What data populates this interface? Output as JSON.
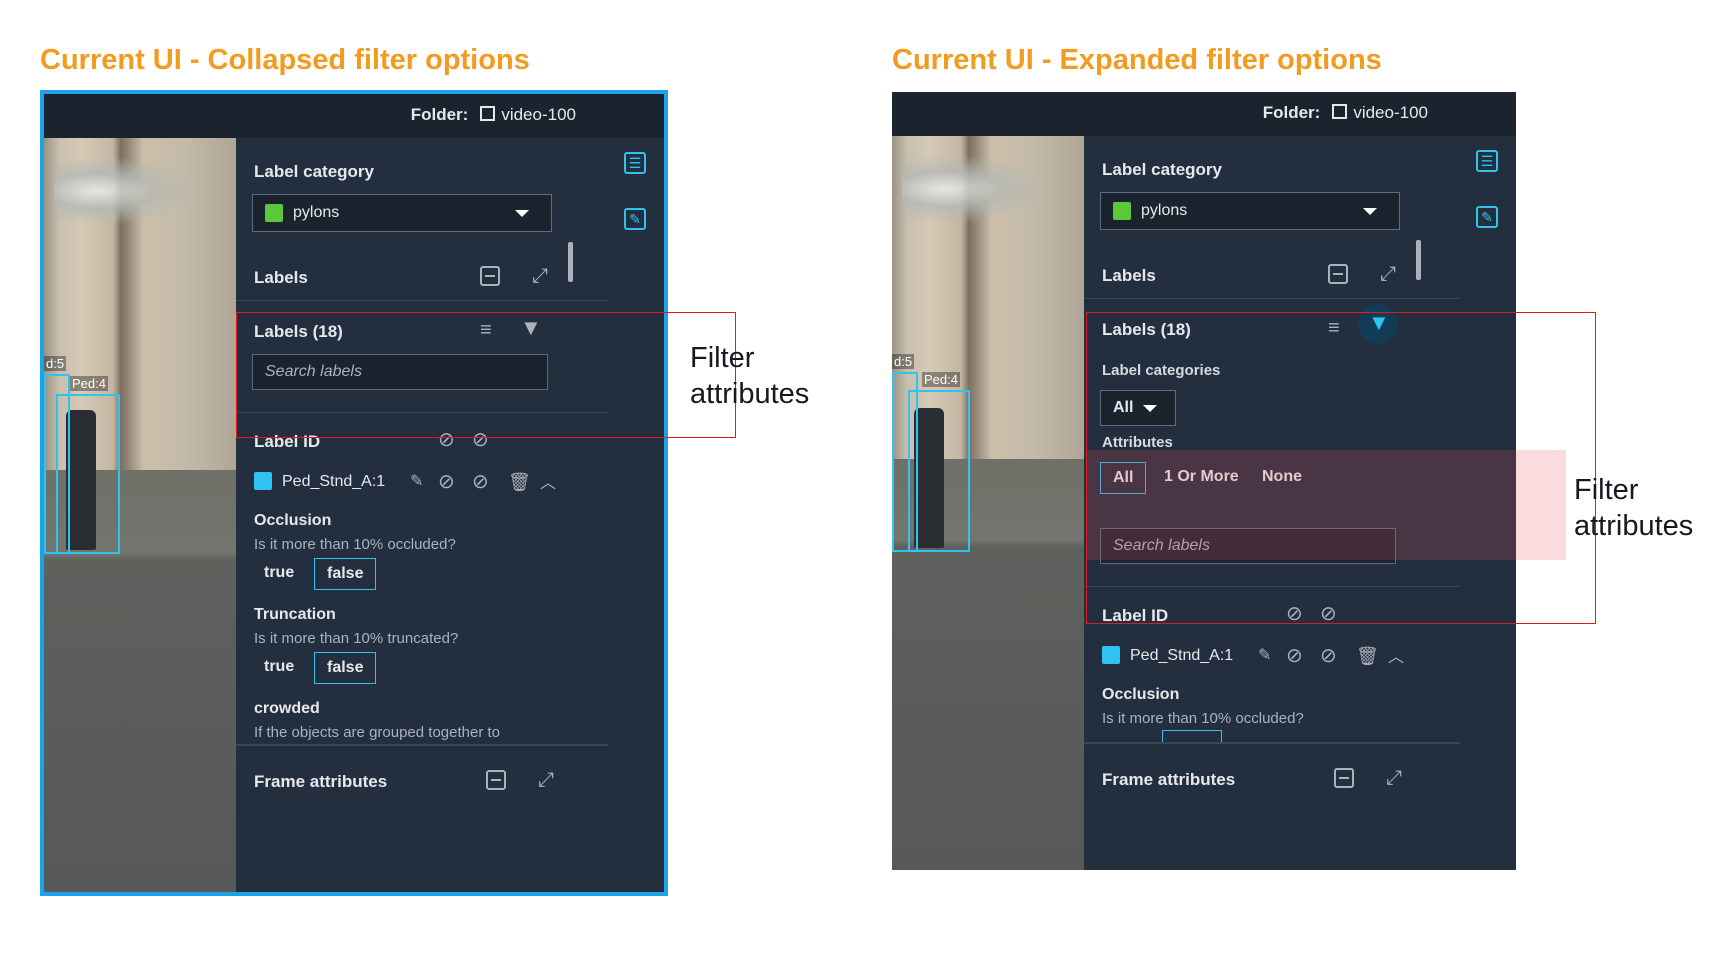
{
  "headings": {
    "left": "Current UI - Collapsed filter options",
    "right": "Current UI - Expanded filter options"
  },
  "colors": {
    "heading": "#f29b1e",
    "panel_bg": "#232f3e",
    "accent": "#2ec4ef",
    "highlight_red": "#e11b22",
    "category_green": "#5ac83a"
  },
  "callouts": {
    "left": [
      "Filter",
      "attributes"
    ],
    "right": [
      "Filter",
      "attributes"
    ]
  },
  "left_panel": {
    "folder_label": "Folder:",
    "folder_name": "video-100",
    "label_category_title": "Label category",
    "selected_category": "pylons",
    "labels_section": "Labels",
    "labels_count": "Labels (18)",
    "search_placeholder": "Search labels",
    "label_id_header": "Label ID",
    "label_item": "Ped_Stnd_A:1",
    "attributes": [
      {
        "name": "Occlusion",
        "question": "Is it more than 10% occluded?",
        "options": [
          "true",
          "false"
        ],
        "selected": "false"
      },
      {
        "name": "Truncation",
        "question": "Is it more than 10% truncated?",
        "options": [
          "true",
          "false"
        ],
        "selected": "false"
      },
      {
        "name": "crowded",
        "question": "If the objects are grouped together to"
      }
    ],
    "frame_attributes": "Frame attributes",
    "boxes": [
      "d:5",
      "Ped:4"
    ]
  },
  "right_panel": {
    "folder_label": "Folder:",
    "folder_name": "video-100",
    "label_category_title": "Label category",
    "selected_category": "pylons",
    "labels_section": "Labels",
    "labels_count": "Labels (18)",
    "label_categories_title": "Label categories",
    "label_categories_value": "All",
    "attributes_title": "Attributes",
    "attribute_filters": [
      "All",
      "1 Or More",
      "None"
    ],
    "attribute_filter_selected": "All",
    "search_placeholder": "Search labels",
    "label_id_header": "Label ID",
    "label_item": "Ped_Stnd_A:1",
    "occlusion_name": "Occlusion",
    "occlusion_question": "Is it more than 10% occluded?",
    "frame_attributes": "Frame attributes",
    "boxes": [
      "d:5",
      "Ped:4"
    ]
  }
}
